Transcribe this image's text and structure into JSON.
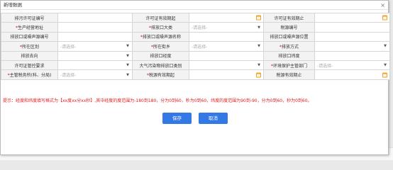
{
  "dialog": {
    "title": "新增数据",
    "close": "×"
  },
  "rows": [
    [
      {
        "label": "排污许可证编号",
        "required": false
      },
      {
        "type": "text",
        "value": ""
      },
      {
        "label": "许可证有效期起",
        "required": false
      },
      {
        "type": "date",
        "value": ""
      },
      {
        "label": "许可证有效期止",
        "required": false
      },
      {
        "type": "date",
        "value": ""
      }
    ],
    [
      {
        "label": "生产经营地址",
        "required": true
      },
      {
        "type": "text",
        "value": ""
      },
      {
        "label": "排放口大类",
        "required": true
      },
      {
        "type": "select",
        "value": "",
        "placeholder": "-请选择-"
      },
      {
        "label": "税源编号",
        "required": false
      },
      {
        "type": "text",
        "value": ""
      }
    ],
    [
      {
        "label": "排放口或噪声源编号",
        "required": false
      },
      {
        "type": "text",
        "value": ""
      },
      {
        "label": "排放口或噪声源名称",
        "required": true
      },
      {
        "type": "text",
        "value": ""
      },
      {
        "label": "排放口或噪声源位置",
        "required": false
      },
      {
        "type": "text",
        "value": ""
      }
    ],
    [
      {
        "label": "所在区划",
        "required": true
      },
      {
        "type": "select",
        "value": "",
        "placeholder": "-请选择-"
      },
      {
        "label": "所在街乡",
        "required": true
      },
      {
        "type": "select",
        "value": "",
        "placeholder": "-请选择-"
      },
      {
        "label": "排放方式",
        "required": true
      },
      {
        "type": "select",
        "value": "",
        "placeholder": ""
      }
    ],
    [
      {
        "label": "排放去向",
        "required": false
      },
      {
        "type": "select",
        "value": "",
        "placeholder": ""
      },
      {
        "label": "排放口经度",
        "required": false
      },
      {
        "type": "text",
        "value": ""
      },
      {
        "label": "排放口纬度",
        "required": false
      },
      {
        "type": "text",
        "value": ""
      }
    ],
    [
      {
        "label": "许可证管控要求",
        "required": false
      },
      {
        "type": "select",
        "value": "",
        "placeholder": ""
      },
      {
        "label": "大气污染物排放口类别",
        "required": false
      },
      {
        "type": "select",
        "value": "",
        "placeholder": ""
      },
      {
        "label": "环境保护主管部门",
        "required": true
      },
      {
        "type": "select",
        "value": "",
        "placeholder": "-请选择-"
      }
    ],
    [
      {
        "label": "主管税务所(科、分局)",
        "required": true
      },
      {
        "type": "select",
        "value": "",
        "placeholder": "-请选择-"
      },
      {
        "label": "税源有效期起",
        "required": true
      },
      {
        "type": "date",
        "value": ""
      },
      {
        "label": "税源有效期止",
        "required": false
      },
      {
        "type": "date",
        "value": ""
      }
    ]
  ],
  "hint": "提示：经度和纬度填写格式为【xx度xx分xx秒】,其中经度的度范围为-180到180，分为0到60，秒为0到60，纬度的度范围为90到-90，分为0到60，秒为0到60。",
  "buttons": {
    "save": "保存",
    "cancel": "取消"
  },
  "colors": {
    "primary": "#3379e6",
    "required": "#dd0000",
    "calendar": "#f0a12b"
  }
}
